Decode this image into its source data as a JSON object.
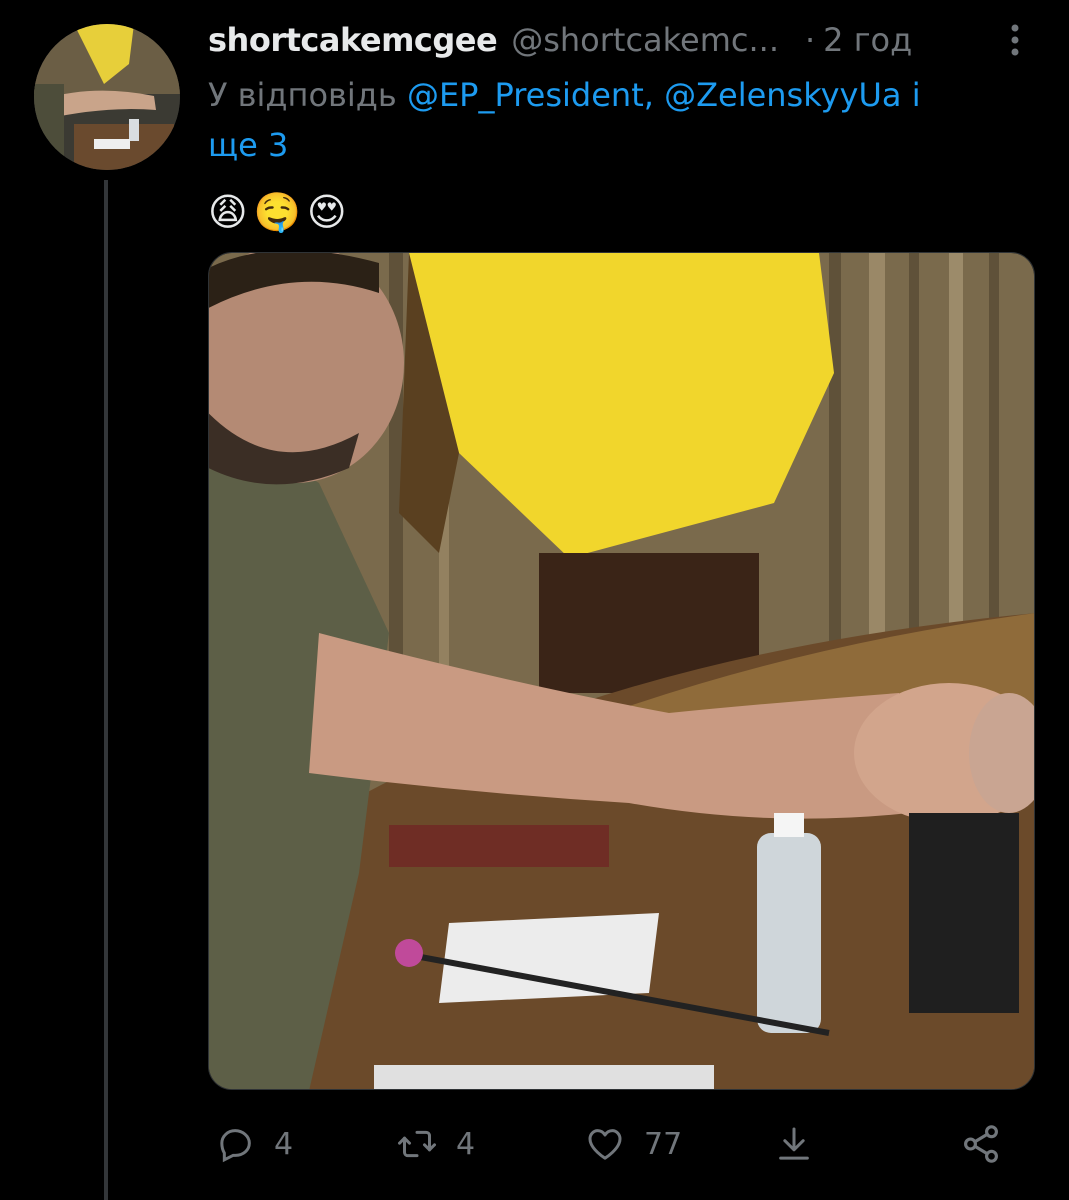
{
  "tweet": {
    "display_name": "shortcakemcgee",
    "handle": "@shortcakemc...",
    "separator": "·",
    "time": "2 год",
    "reply_prefix": "У відповідь",
    "mention_1": "@EP_President,",
    "mention_2": "@ZelenskyyUa",
    "reply_conjunction": "і",
    "reply_more": "ще 3",
    "emojis": [
      "😩",
      "🤤",
      "😍"
    ]
  },
  "actions": {
    "reply_count": "4",
    "retweet_count": "4",
    "like_count": "77"
  },
  "colors": {
    "background": "#000000",
    "text_primary": "#e7e9ea",
    "text_secondary": "#71767b",
    "link": "#1d9bf0",
    "thread_line": "#333639"
  },
  "icons": {
    "more": "more-vertical-icon",
    "reply": "reply-icon",
    "retweet": "retweet-icon",
    "like": "heart-icon",
    "share_download": "download-icon",
    "share": "share-icon"
  }
}
